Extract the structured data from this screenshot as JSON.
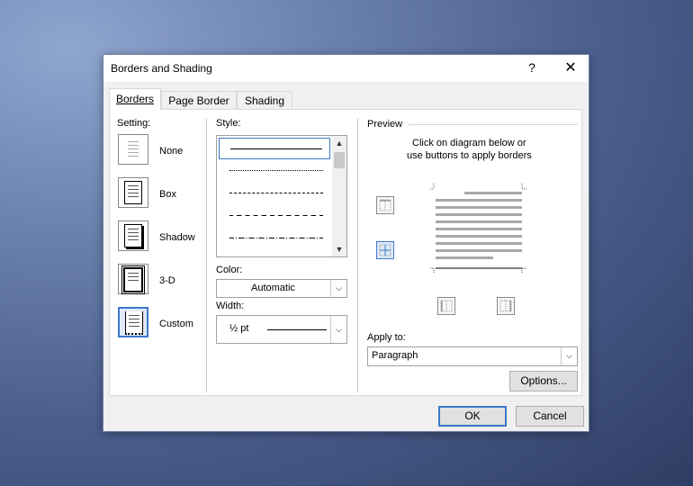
{
  "dialog": {
    "title": "Borders and Shading",
    "help_label": "?",
    "close_label": "✕"
  },
  "tabs": [
    {
      "label": "Borders",
      "active": true
    },
    {
      "label": "Page Border",
      "active": false
    },
    {
      "label": "Shading",
      "active": false
    }
  ],
  "setting": {
    "label": "Setting:",
    "options": [
      {
        "label": "None"
      },
      {
        "label": "Box"
      },
      {
        "label": "Shadow"
      },
      {
        "label": "3-D"
      },
      {
        "label": "Custom",
        "selected": true
      }
    ]
  },
  "style": {
    "label": "Style:",
    "scroll_up": "▲",
    "scroll_down": "▼"
  },
  "color": {
    "label": "Color:",
    "value": "Automatic"
  },
  "width": {
    "label": "Width:",
    "value": "½ pt"
  },
  "preview": {
    "label": "Preview",
    "instruction_line1": "Click on diagram below or",
    "instruction_line2": "use buttons to apply borders"
  },
  "apply_to": {
    "label": "Apply to:",
    "value": "Paragraph"
  },
  "buttons": {
    "options": "Options...",
    "ok": "OK",
    "cancel": "Cancel"
  },
  "colors": {
    "accent": "#3c78c8",
    "dialog_bg": "#f0f0f0"
  }
}
